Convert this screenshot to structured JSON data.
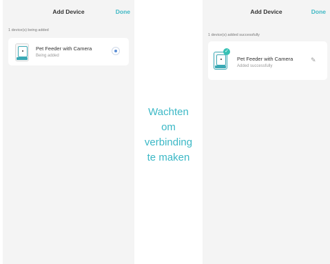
{
  "left_screen": {
    "header": {
      "title": "Add Device",
      "done_label": "Done"
    },
    "status_text": "1 device(s) being added",
    "device": {
      "name": "Pet Feeder with Camera",
      "status": "Being added",
      "icon": "pet-feeder-icon",
      "progress_icon": "spinner-icon"
    }
  },
  "right_screen": {
    "header": {
      "title": "Add Device",
      "done_label": "Done"
    },
    "status_text": "1 device(s) added successfully",
    "device": {
      "name": "Pet Feeder with Camera",
      "status": "Added successfully",
      "icon": "pet-feeder-icon",
      "badge_icon": "check-icon",
      "edit_icon": "pencil-icon"
    }
  },
  "caption_lines": [
    "Wachten",
    "om",
    "verbinding",
    "te maken"
  ],
  "colors": {
    "accent": "#3fb8c4",
    "caption": "#3bb8c6",
    "badge": "#36c1b4",
    "panel_bg": "#f4f4f4"
  }
}
